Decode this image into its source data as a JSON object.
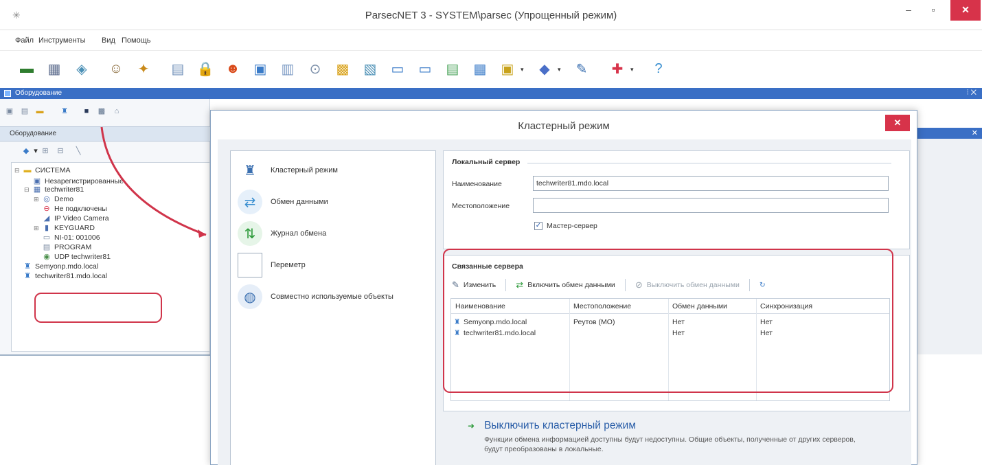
{
  "window": {
    "title": "ParsecNET 3 - SYSTEM\\parsec (Упрощенный режим)",
    "min_glyph": "–",
    "max_glyph": "▫",
    "close_glyph": "✕"
  },
  "menu": [
    "Файл",
    "Инструменты",
    "Вид",
    "Помощь"
  ],
  "toolbar_icons": [
    {
      "name": "card-reader-icon",
      "glyph": "▬",
      "color": "#2f7d2f"
    },
    {
      "name": "controller-icon",
      "glyph": "▦",
      "color": "#5b6b8c"
    },
    {
      "name": "network-icon",
      "glyph": "◈",
      "color": "#4a8fb5"
    },
    {
      "name": "person-icon",
      "glyph": "☺",
      "color": "#8a6a3a"
    },
    {
      "name": "schedule-icon",
      "glyph": "✦",
      "color": "#c98a1a"
    },
    {
      "name": "calendar-icon",
      "glyph": "▤",
      "color": "#6f8fb8"
    },
    {
      "name": "lock-icon",
      "glyph": "🔒",
      "color": "#d9a21a"
    },
    {
      "name": "users-icon",
      "glyph": "☻",
      "color": "#d94a1a"
    },
    {
      "name": "monitor-icon",
      "glyph": "▣",
      "color": "#3a7bc8"
    },
    {
      "name": "calendar2-icon",
      "glyph": "▥",
      "color": "#7b9ac4"
    },
    {
      "name": "search-icon",
      "glyph": "⊙",
      "color": "#7a8ea8"
    },
    {
      "name": "photo-id-icon",
      "glyph": "▩",
      "color": "#d9a21a"
    },
    {
      "name": "report-icon",
      "glyph": "▧",
      "color": "#4a8fb5"
    },
    {
      "name": "window-icon",
      "glyph": "▭",
      "color": "#3a7bc8"
    },
    {
      "name": "window2-icon",
      "glyph": "▭",
      "color": "#3a7bc8"
    },
    {
      "name": "document-icon",
      "glyph": "▤",
      "color": "#4aa35a"
    },
    {
      "name": "table-icon",
      "glyph": "▦",
      "color": "#3a7bc8"
    },
    {
      "name": "template-icon",
      "glyph": "▣",
      "color": "#c8a21a"
    },
    {
      "name": "plugin-icon",
      "glyph": "◆",
      "color": "#4a6fc8"
    },
    {
      "name": "wizard-icon",
      "glyph": "✎",
      "color": "#3a6fb0"
    },
    {
      "name": "exit-icon",
      "glyph": "✚",
      "color": "#d7334a"
    },
    {
      "name": "help-icon",
      "glyph": "?",
      "color": "#3a8fd0"
    }
  ],
  "panel": {
    "title": "Оборудование",
    "buttons": "⫶ ✕"
  },
  "left_tab": "Оборудование",
  "tree": [
    {
      "label": "СИСТЕМА",
      "icon": "folder-icon",
      "glyph": "▬",
      "color": "#e0b020",
      "indent": 0,
      "exp": "⊟"
    },
    {
      "label": "Незарегистрированные",
      "icon": "unregistered-icon",
      "glyph": "▣",
      "color": "#4a6fb0",
      "indent": 1,
      "exp": ""
    },
    {
      "label": "techwriter81",
      "icon": "server-icon",
      "glyph": "▦",
      "color": "#4a6fb0",
      "indent": 1,
      "exp": "⊟"
    },
    {
      "label": "Demo",
      "icon": "globe-icon",
      "glyph": "◎",
      "color": "#4a6fb0",
      "indent": 2,
      "exp": "⊞"
    },
    {
      "label": "Не подключены",
      "icon": "disconnected-icon",
      "glyph": "⊖",
      "color": "#d7334a",
      "indent": 2,
      "exp": ""
    },
    {
      "label": "IP Video Camera",
      "icon": "camera-icon",
      "glyph": "◢",
      "color": "#4a6fb0",
      "indent": 2,
      "exp": ""
    },
    {
      "label": "KEYGUARD",
      "icon": "keyguard-icon",
      "glyph": "▮",
      "color": "#4a6fb0",
      "indent": 2,
      "exp": "⊞"
    },
    {
      "label": "NI-01: 001006",
      "icon": "module-icon",
      "glyph": "▭",
      "color": "#7a8aa0",
      "indent": 2,
      "exp": ""
    },
    {
      "label": "PROGRAM",
      "icon": "program-icon",
      "glyph": "▤",
      "color": "#7a8aa0",
      "indent": 2,
      "exp": ""
    },
    {
      "label": "UDP techwriter81",
      "icon": "udp-icon",
      "glyph": "◉",
      "color": "#4a8f4a",
      "indent": 2,
      "exp": ""
    },
    {
      "label": "Semyonp.mdo.local",
      "icon": "cluster-server-icon",
      "glyph": "♜",
      "color": "#3a7bc8",
      "indent": 0,
      "exp": ""
    },
    {
      "label": "techwriter81.mdo.local",
      "icon": "cluster-server-icon",
      "glyph": "♜",
      "color": "#3a7bc8",
      "indent": 0,
      "exp": ""
    }
  ],
  "dialog": {
    "title": "Кластерный режим",
    "close_glyph": "✕",
    "nav": [
      {
        "label": "Кластерный режим",
        "icon": "cluster-mode-icon",
        "glyph": "♜",
        "color": "#3a6fb0",
        "bg": "#ffffff"
      },
      {
        "label": "Обмен данными",
        "icon": "data-exchange-icon",
        "glyph": "⇄",
        "color": "#3a8fd0",
        "bg": "#e6f0fa"
      },
      {
        "label": "Журнал обмена",
        "icon": "exchange-log-icon",
        "glyph": "⇅",
        "color": "#2d9a3a",
        "bg": "#e6f5e8"
      },
      {
        "label": "Переметр",
        "icon": "perimeter-icon",
        "glyph": "",
        "color": "#333333",
        "bg": "#ffffff"
      },
      {
        "label": "Совместно используемые объекты",
        "icon": "shared-objects-icon",
        "glyph": "◍",
        "color": "#3a6fb0",
        "bg": "#e6eef8"
      }
    ],
    "local_server": {
      "title": "Локальный сервер",
      "name_label": "Наименование",
      "name_value": "techwriter81.mdo.local",
      "location_label": "Местоположение",
      "location_value": "",
      "master_label": "Мастер-сервер",
      "master_checked": "✓"
    },
    "linked": {
      "title": "Связанные сервера",
      "actions": [
        {
          "label": "Изменить",
          "glyph": "✎",
          "color": "#5a6f8a",
          "disabled": false,
          "name": "edit-button",
          "icon": "edit-icon"
        },
        {
          "label": "Включить обмен данными",
          "glyph": "⇄",
          "color": "#2d9a3a",
          "disabled": false,
          "name": "enable-exchange-button",
          "icon": "enable-exchange-icon"
        },
        {
          "label": "Выключить обмен данными",
          "glyph": "⊘",
          "color": "#9aa4ae",
          "disabled": true,
          "name": "disable-exchange-button",
          "icon": "disable-exchange-icon"
        }
      ],
      "refresh_glyph": "↻",
      "columns": [
        "Наименование",
        "Местоположение",
        "Обмен данными",
        "Синхронизация"
      ],
      "rows": [
        [
          "Semyonp.mdo.local",
          "Реутов (МО)",
          "Нет",
          "Нет"
        ],
        [
          "techwriter81.mdo.local",
          "",
          "Нет",
          "Нет"
        ]
      ],
      "row_glyph": "♜"
    },
    "disable_action": {
      "glyph": "➜",
      "title": "Выключить кластерный режим",
      "description": "Функции обмена информацией доступны будут недоступны. Общие объекты, полученные от других серверов, будут преобразованы в локальные."
    }
  },
  "colors": {
    "highlight": "#d0344a",
    "panel_blue": "#3a6fc5",
    "link_blue": "#2a5ea8",
    "close_red": "#d7334a"
  }
}
